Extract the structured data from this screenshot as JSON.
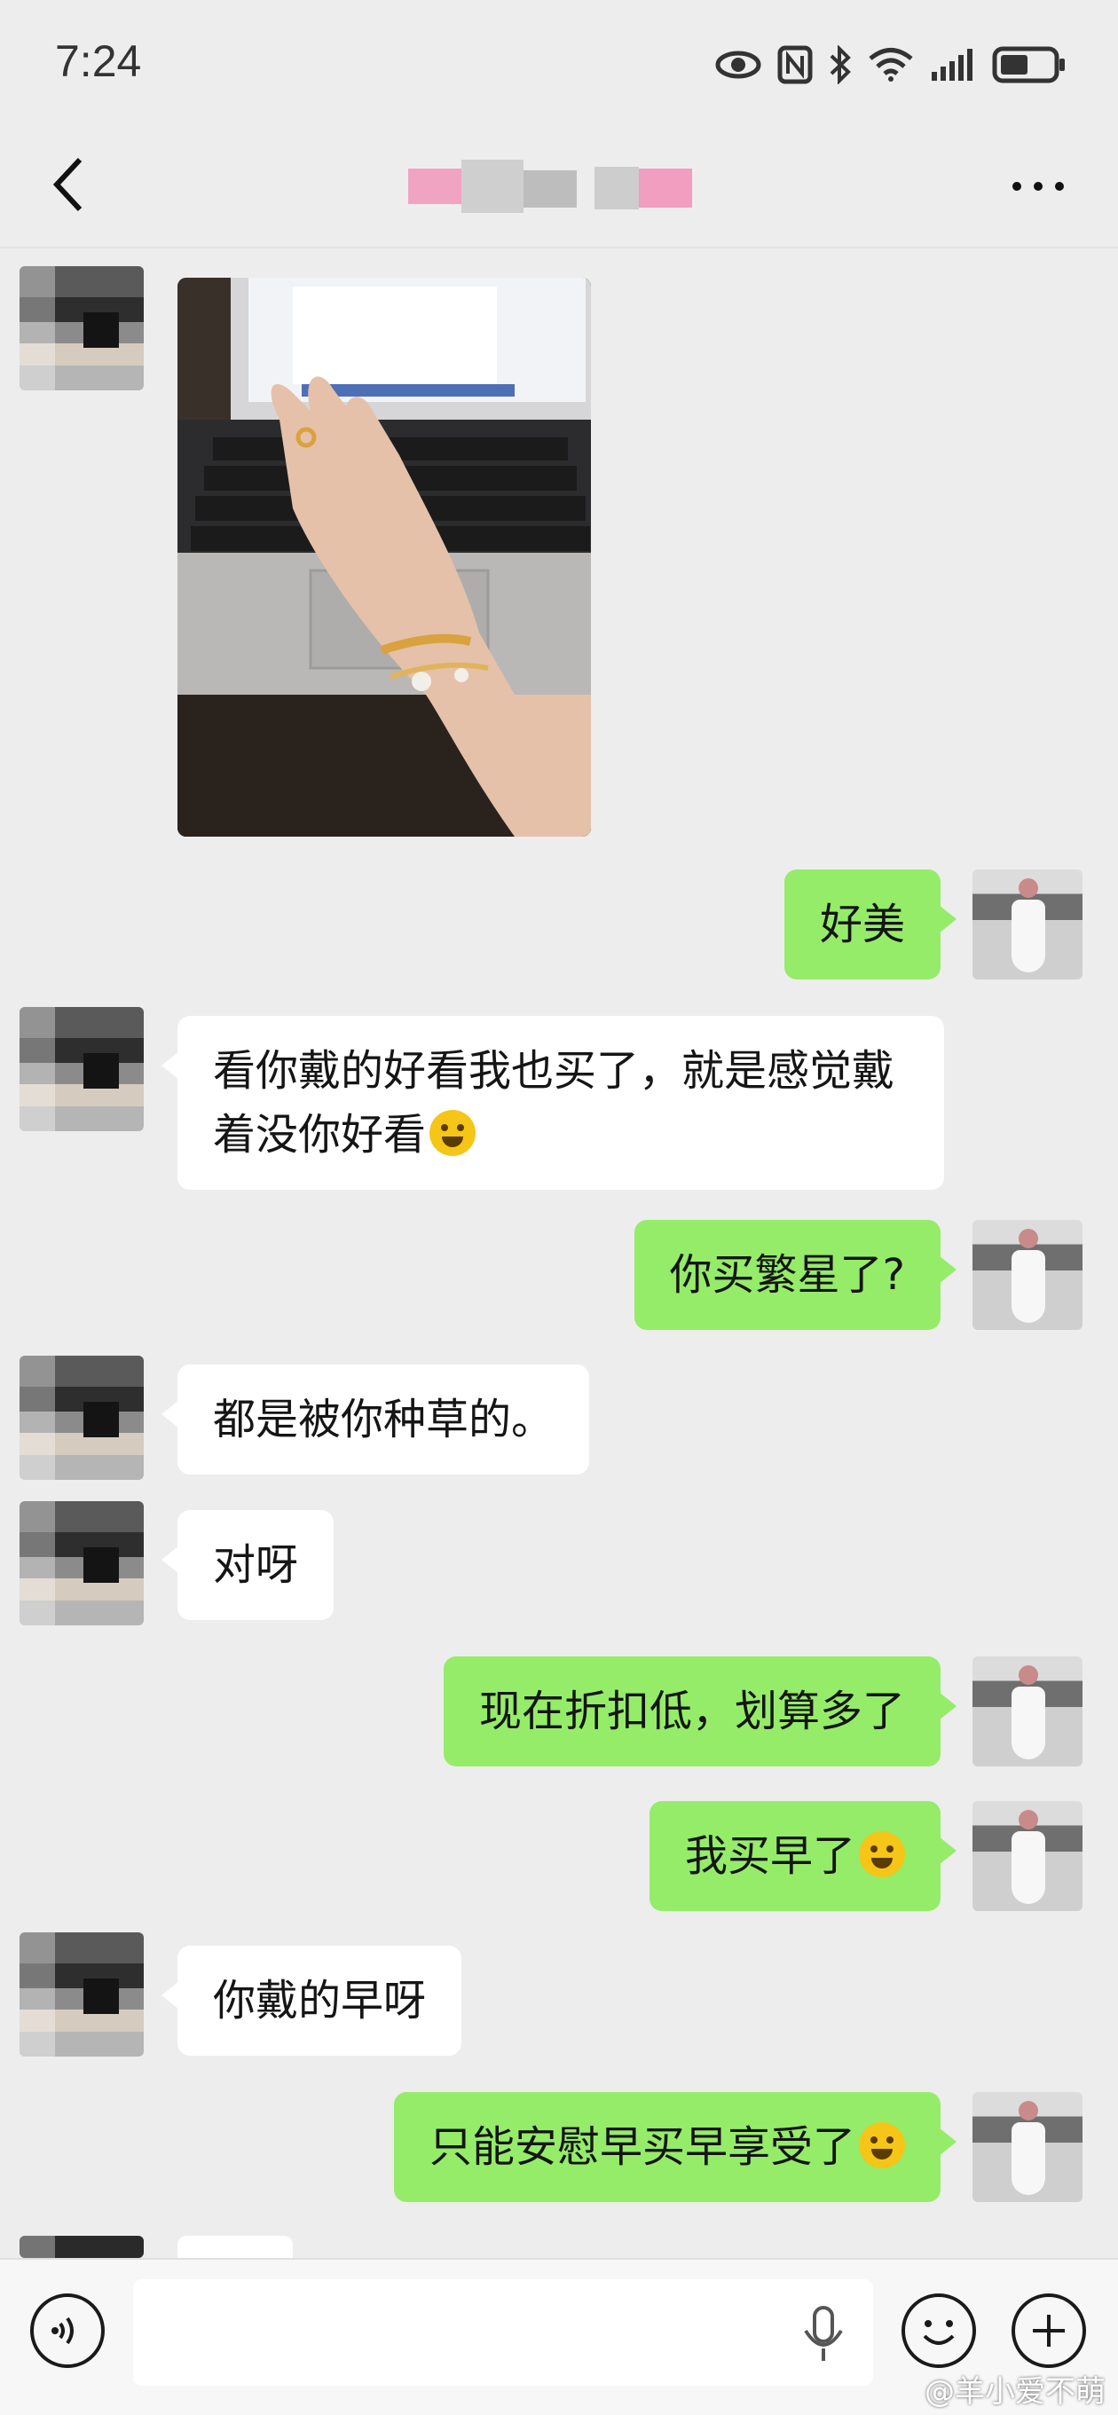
{
  "status_bar": {
    "time": "7:24"
  },
  "nav": {
    "back_icon": "chevron-left-icon",
    "more_icon": "more-horizontal-icon"
  },
  "messages": [
    {
      "side": "in",
      "type": "image"
    },
    {
      "side": "out",
      "text": "好美"
    },
    {
      "side": "in",
      "text": "看你戴的好看我也买了，就是感觉戴着没你好看",
      "emoji": "laugh-cry-emoji"
    },
    {
      "side": "out",
      "text": "你买繁星了?"
    },
    {
      "side": "in",
      "text": "都是被你种草的。"
    },
    {
      "side": "in",
      "text": "对呀"
    },
    {
      "side": "out",
      "text": "现在折扣低，划算多了"
    },
    {
      "side": "out",
      "text": "我买早了",
      "emoji": "crying-emoji"
    },
    {
      "side": "in",
      "text": "你戴的早呀"
    },
    {
      "side": "out",
      "text": "只能安慰早买早享受了",
      "emoji": "thinking-emoji"
    }
  ],
  "input_bar": {
    "voice_icon": "voice-icon",
    "mic_icon": "microphone-icon",
    "emoji_icon": "smiley-icon",
    "add_icon": "plus-icon",
    "value": ""
  },
  "watermark": "@羊小爱不萌",
  "colors": {
    "outgoing_bubble": "#95ec69",
    "incoming_bubble": "#ffffff",
    "background": "#ededed"
  }
}
